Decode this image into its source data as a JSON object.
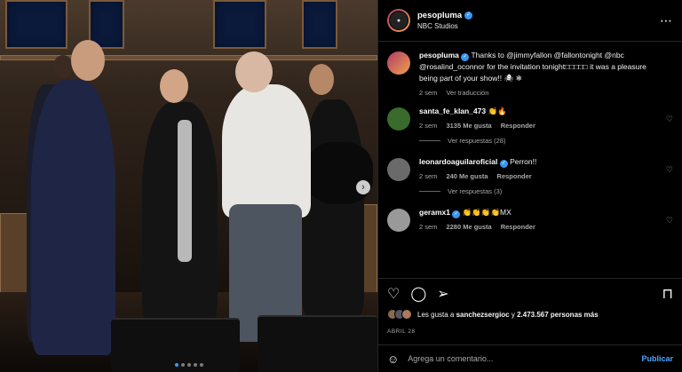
{
  "post": {
    "username": "pesopluma",
    "location": "NBC Studios",
    "caption_user": "pesopluma",
    "caption": "Thanks to @jimmyfallon @fallontonight @nbc @rosalind_oconnor for the invitation tonight□□□□□ it was a pleasure being part of your show!! 🕷 ❄",
    "caption_time": "2 sem",
    "caption_action": "Ver traducción"
  },
  "comments": [
    {
      "user": "santa_fe_klan_473",
      "text": "👏🔥",
      "time": "2 sem",
      "likes": "3135 Me gusta",
      "reply": "Responder",
      "replies": "Ver respuestas (28)"
    },
    {
      "user": "leonardoaguilaroficial",
      "text": "Perron!!",
      "time": "2 sem",
      "likes": "240 Me gusta",
      "reply": "Responder",
      "replies": "Ver respuestas (3)"
    },
    {
      "user": "geramx1",
      "text": "👏👏👏👏MX",
      "time": "2 sem",
      "likes": "2280 Me gusta",
      "reply": "Responder"
    }
  ],
  "likes": {
    "prefix": "Les gusta a ",
    "user": "sanchezsergioc",
    "middle": " y ",
    "count": "2.473.567 personas más"
  },
  "date": "ABRIL 28",
  "composer": {
    "placeholder": "Agrega un comentario...",
    "publish": "Publicar"
  },
  "colors": {
    "accent": "#3897f0",
    "background": "#000000"
  }
}
